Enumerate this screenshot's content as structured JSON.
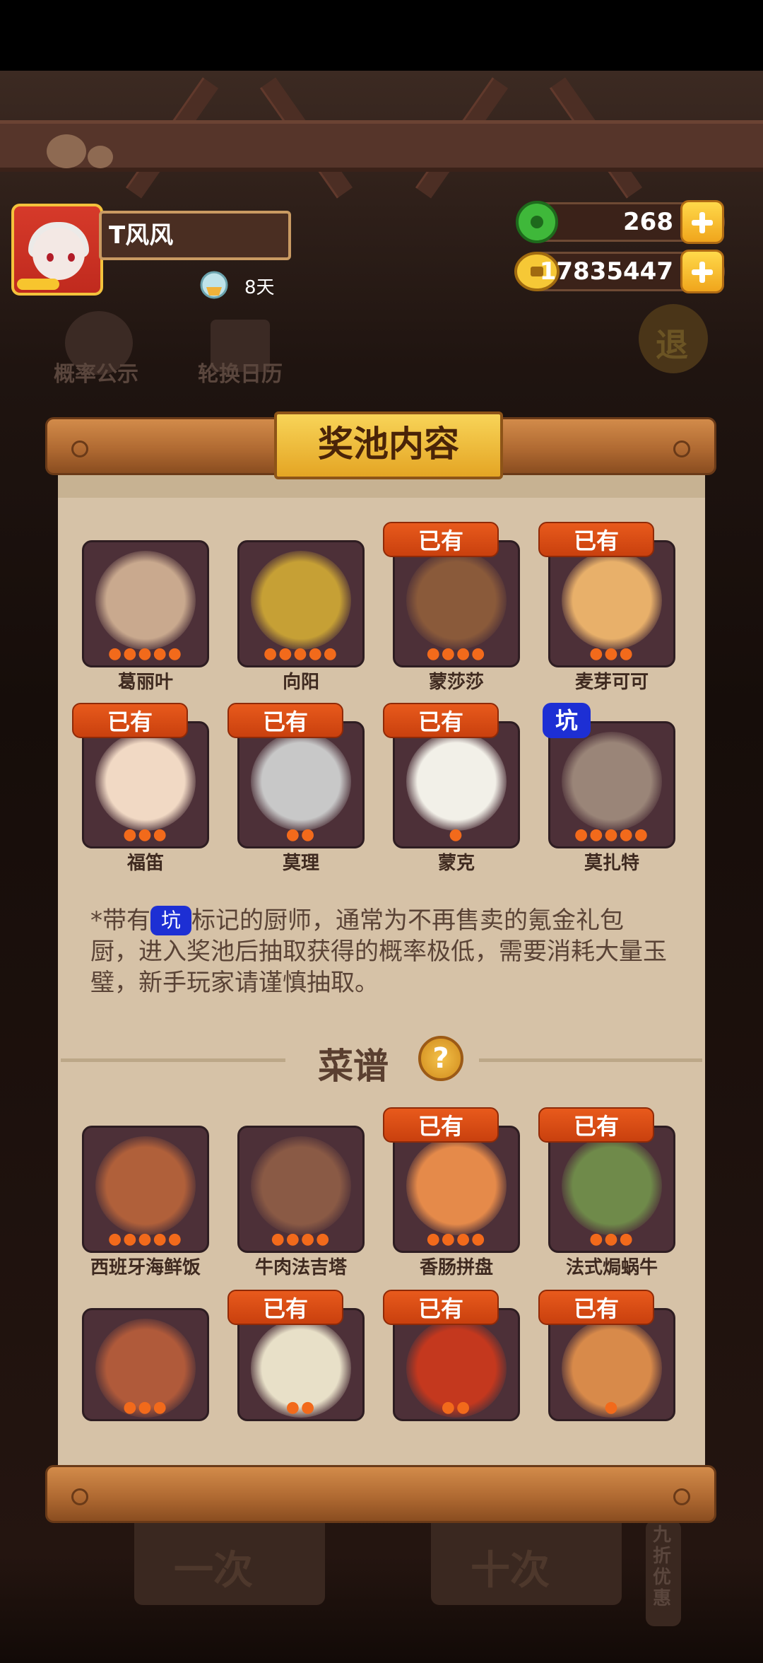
{
  "header": {
    "player_name": "T风风",
    "timer_text": "8天",
    "jade_amount": "268",
    "coin_amount": "17835447"
  },
  "background": {
    "btn_probability": "概率公示",
    "btn_calendar": "轮换日历",
    "btn_exit": "退",
    "btn_single": "一次",
    "btn_ten": "十次",
    "discount": "九折优惠"
  },
  "modal": {
    "title": "奖池内容",
    "owned_label": "已有",
    "pit_label": "坑",
    "chefs": [
      {
        "name": "葛丽叶",
        "owned": false,
        "pit": false,
        "stars": 5,
        "color": "#c9a98e"
      },
      {
        "name": "向阳",
        "owned": false,
        "pit": false,
        "stars": 5,
        "color": "#c6a035"
      },
      {
        "name": "蒙莎莎",
        "owned": true,
        "pit": false,
        "stars": 4,
        "color": "#8a5a3a"
      },
      {
        "name": "麦芽可可",
        "owned": true,
        "pit": false,
        "stars": 3,
        "color": "#e8b06a"
      },
      {
        "name": "福笛",
        "owned": true,
        "pit": false,
        "stars": 3,
        "color": "#f1d9c4"
      },
      {
        "name": "莫理",
        "owned": true,
        "pit": false,
        "stars": 2,
        "color": "#c8c8c8"
      },
      {
        "name": "蒙克",
        "owned": true,
        "pit": false,
        "stars": 1,
        "color": "#f2f0e8"
      },
      {
        "name": "莫扎特",
        "owned": false,
        "pit": true,
        "stars": 5,
        "color": "#9a8578"
      }
    ],
    "note_prefix": "*带有",
    "note_tag": "坑",
    "note_suffix": "标记的厨师，通常为不再售卖的氪金礼包厨，进入奖池后抽取获得的概率极低，需要消耗大量玉璧，新手玩家请谨慎抽取。",
    "recipe_title": "菜谱",
    "help_label": "?",
    "recipes": [
      {
        "name": "西班牙海鲜饭",
        "owned": false,
        "stars": 5,
        "color": "#b0603a"
      },
      {
        "name": "牛肉法吉塔",
        "owned": false,
        "stars": 4,
        "color": "#8a5a45"
      },
      {
        "name": "香肠拼盘",
        "owned": true,
        "stars": 4,
        "color": "#e58a4a"
      },
      {
        "name": "法式焗蜗牛",
        "owned": true,
        "stars": 3,
        "color": "#6f8a4a"
      },
      {
        "name": "",
        "owned": false,
        "stars": 3,
        "color": "#b05a3a"
      },
      {
        "name": "",
        "owned": true,
        "stars": 2,
        "color": "#e8e0c8"
      },
      {
        "name": "",
        "owned": true,
        "stars": 2,
        "color": "#c4381e"
      },
      {
        "name": "",
        "owned": true,
        "stars": 1,
        "color": "#d88a4a"
      }
    ]
  }
}
